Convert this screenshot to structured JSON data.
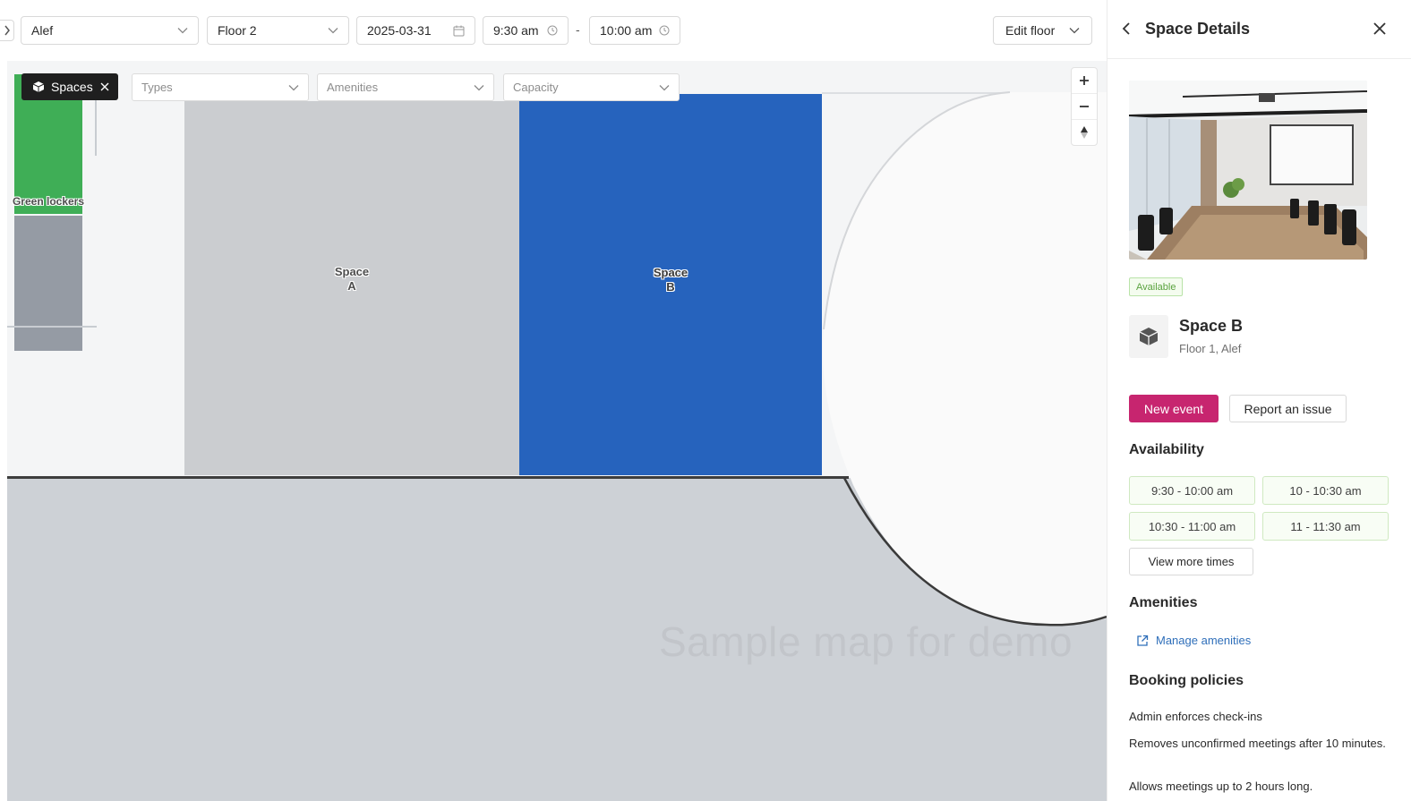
{
  "toolbar": {
    "building": "Alef",
    "floor": "Floor 2",
    "date": "2025-03-31",
    "start_time": "9:30 am",
    "separator": "-",
    "end_time": "10:00 am",
    "edit_floor": "Edit floor"
  },
  "filters": {
    "chip_label": "Spaces",
    "types": "Types",
    "amenities": "Amenities",
    "capacity": "Capacity"
  },
  "map": {
    "green_lockers": "Green lockers",
    "space_a": "Space\nA",
    "space_b": "Space\nB",
    "watermark": "Sample map for demo",
    "zoom_in": "+",
    "zoom_out": "−"
  },
  "panel": {
    "title": "Space Details",
    "status": "Available",
    "space_name": "Space B",
    "space_location": "Floor 1, Alef",
    "new_event": "New event",
    "report_issue": "Report an issue",
    "availability_heading": "Availability",
    "slots": [
      "9:30 - 10:00 am",
      "10 - 10:30 am",
      "10:30 - 11:00 am",
      "11 - 11:30 am"
    ],
    "view_more": "View more times",
    "amenities_heading": "Amenities",
    "manage_amenities": "Manage amenities",
    "policies_heading": "Booking policies",
    "policies": [
      "Admin enforces check-ins",
      "Removes unconfirmed meetings after 10 minutes.",
      "Allows meetings up to 2 hours long."
    ]
  },
  "colors": {
    "accent": "#c7256f",
    "space_b_fill": "#2663bd",
    "lockers_green": "#3fae56",
    "available_green": "#5aa33f",
    "link_blue": "#2f6fba"
  },
  "icons": {
    "expand": "chevron-right-icon",
    "dropdown": "chevron-down-icon",
    "calendar": "calendar-icon",
    "clock": "clock-icon",
    "cube": "cube-icon",
    "back": "chevron-left-icon",
    "close": "close-icon",
    "external": "external-link-icon",
    "compass": "compass-icon"
  }
}
